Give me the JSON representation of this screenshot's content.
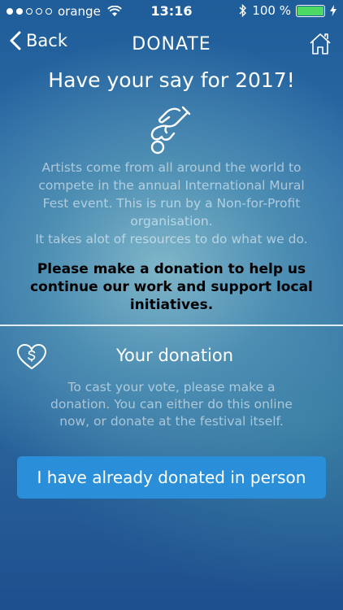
{
  "status_bar": {
    "carrier": "orange",
    "time": "13:16",
    "battery": "100 %",
    "battery_level": 1.0,
    "signal_bars": 2
  },
  "nav": {
    "back_label": "Back",
    "title": "DONATE"
  },
  "headline": "Have your say for 2017!",
  "intro": {
    "paragraph": "Artists come from all around the world to compete in the annual International Mural Fest event. This is run by a Non-for-Profit organisation.",
    "line2": "It takes alot of resources to do what we do."
  },
  "appeal": "Please make a donation to help us continue our work and support local initiatives.",
  "donation": {
    "title": "Your donation",
    "text": "To cast your vote, please make a donation. You can either do this online now, or donate at the festival itself."
  },
  "cta_label": "I have already donated in person",
  "icons": [
    "wifi-icon",
    "bluetooth-icon",
    "battery-icon",
    "charging-icon",
    "chevron-left-icon",
    "home-icon",
    "hand-coin-icon",
    "heart-dollar-icon"
  ]
}
